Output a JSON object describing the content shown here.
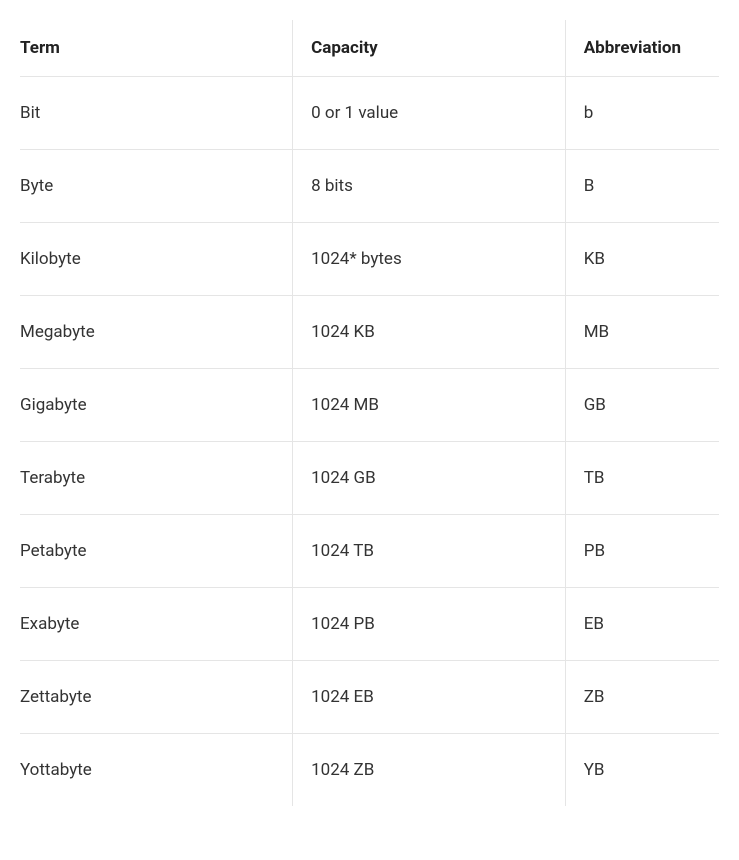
{
  "table": {
    "headers": {
      "term": "Term",
      "capacity": "Capacity",
      "abbreviation": "Abbreviation"
    },
    "rows": [
      {
        "term": "Bit",
        "capacity": "0 or 1 value",
        "abbreviation": "b"
      },
      {
        "term": "Byte",
        "capacity": "8 bits",
        "abbreviation": "B"
      },
      {
        "term": "Kilobyte",
        "capacity": "1024* bytes",
        "abbreviation": "KB"
      },
      {
        "term": "Megabyte",
        "capacity": "1024 KB",
        "abbreviation": "MB"
      },
      {
        "term": "Gigabyte",
        "capacity": "1024 MB",
        "abbreviation": "GB"
      },
      {
        "term": "Terabyte",
        "capacity": "1024 GB",
        "abbreviation": "TB"
      },
      {
        "term": "Petabyte",
        "capacity": "1024 TB",
        "abbreviation": "PB"
      },
      {
        "term": "Exabyte",
        "capacity": "1024 PB",
        "abbreviation": "EB"
      },
      {
        "term": "Zettabyte",
        "capacity": "1024 EB",
        "abbreviation": "ZB"
      },
      {
        "term": "Yottabyte",
        "capacity": "1024 ZB",
        "abbreviation": "YB"
      }
    ]
  }
}
